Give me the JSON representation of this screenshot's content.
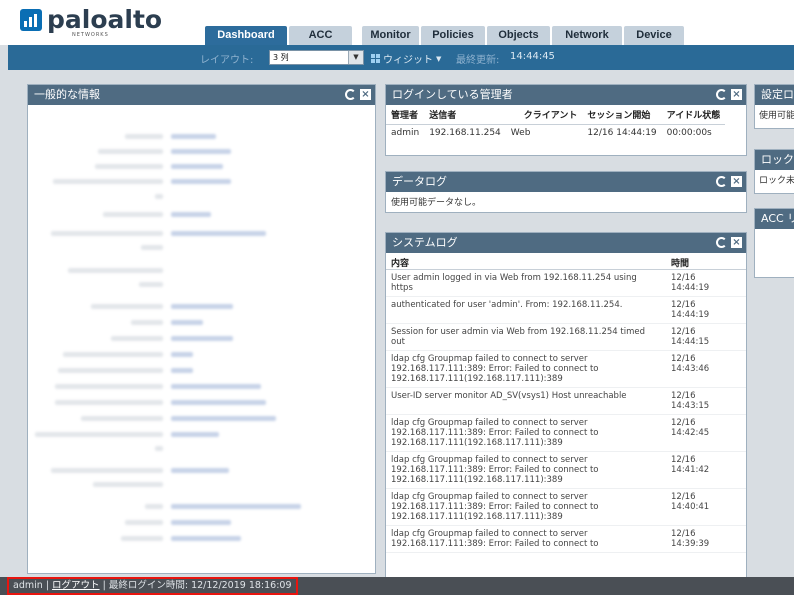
{
  "brand": {
    "name": "paloalto",
    "sub": "NETWORKS",
    "mark_color": "#0a6eb4"
  },
  "nav": {
    "tabs": [
      {
        "label": "Dashboard",
        "active": true
      },
      {
        "label": "ACC"
      },
      {
        "label": "Monitor"
      },
      {
        "label": "Policies"
      },
      {
        "label": "Objects"
      },
      {
        "label": "Network"
      },
      {
        "label": "Device"
      }
    ]
  },
  "toolbar": {
    "layout_label": "レイアウト:",
    "layout_value": "3 列",
    "widget_label": "ウィジット",
    "updated_label": "最終更新:",
    "updated_time": "14:44:45"
  },
  "general_info": {
    "title": "一般的な情報"
  },
  "logged_in_admins": {
    "title": "ログインしている管理者",
    "columns": [
      "管理者",
      "送信者",
      "クライアント",
      "セッション開始",
      "アイドル状態"
    ],
    "rows": [
      [
        "admin",
        "192.168.11.254",
        "Web",
        "12/16 14:44:19",
        "00:00:00s"
      ]
    ]
  },
  "data_log": {
    "title": "データログ",
    "empty_text": "使用可能データなし。"
  },
  "system_log": {
    "title": "システムログ",
    "col_content": "内容",
    "col_time": "時間",
    "rows": [
      {
        "msg": "User admin logged in via Web from 192.168.11.254 using https",
        "time": "12/16 14:44:19"
      },
      {
        "msg": "authenticated for user 'admin'. From: 192.168.11.254.",
        "time": "12/16 14:44:19"
      },
      {
        "msg": "Session for user admin via Web from 192.168.11.254 timed out",
        "time": "12/16 14:44:15"
      },
      {
        "msg": "ldap cfg Groupmap failed to connect to server 192.168.117.111:389: Error: Failed to connect to 192.168.117.111(192.168.117.111):389",
        "time": "12/16 14:43:46"
      },
      {
        "msg": "User-ID server monitor AD_SV(vsys1) Host unreachable",
        "time": "12/16 14:43:15"
      },
      {
        "msg": "ldap cfg Groupmap failed to connect to server 192.168.117.111:389: Error: Failed to connect to 192.168.117.111(192.168.117.111):389",
        "time": "12/16 14:42:45"
      },
      {
        "msg": "ldap cfg Groupmap failed to connect to server 192.168.117.111:389: Error: Failed to connect to 192.168.117.111(192.168.117.111):389",
        "time": "12/16 14:41:42"
      },
      {
        "msg": "ldap cfg Groupmap failed to connect to server 192.168.117.111:389: Error: Failed to connect to 192.168.117.111(192.168.117.111):389",
        "time": "12/16 14:40:41"
      },
      {
        "msg": "ldap cfg Groupmap failed to connect to server 192.168.117.111:389: Error: Failed to connect to",
        "time": "12/16 14:39:39"
      }
    ]
  },
  "side_panels": {
    "config_logs": {
      "title": "設定ロ",
      "content": "使用可能"
    },
    "locks": {
      "title": "ロック",
      "content": "ロック未"
    },
    "acc_risk": {
      "title": "ACC リ"
    }
  },
  "footer": {
    "user": "admin",
    "sep1": "|",
    "logout": "ログアウト",
    "sep2": "|",
    "last_login_label": "最終ログイン時間:",
    "last_login_time": "12/12/2019 18:16:09"
  }
}
